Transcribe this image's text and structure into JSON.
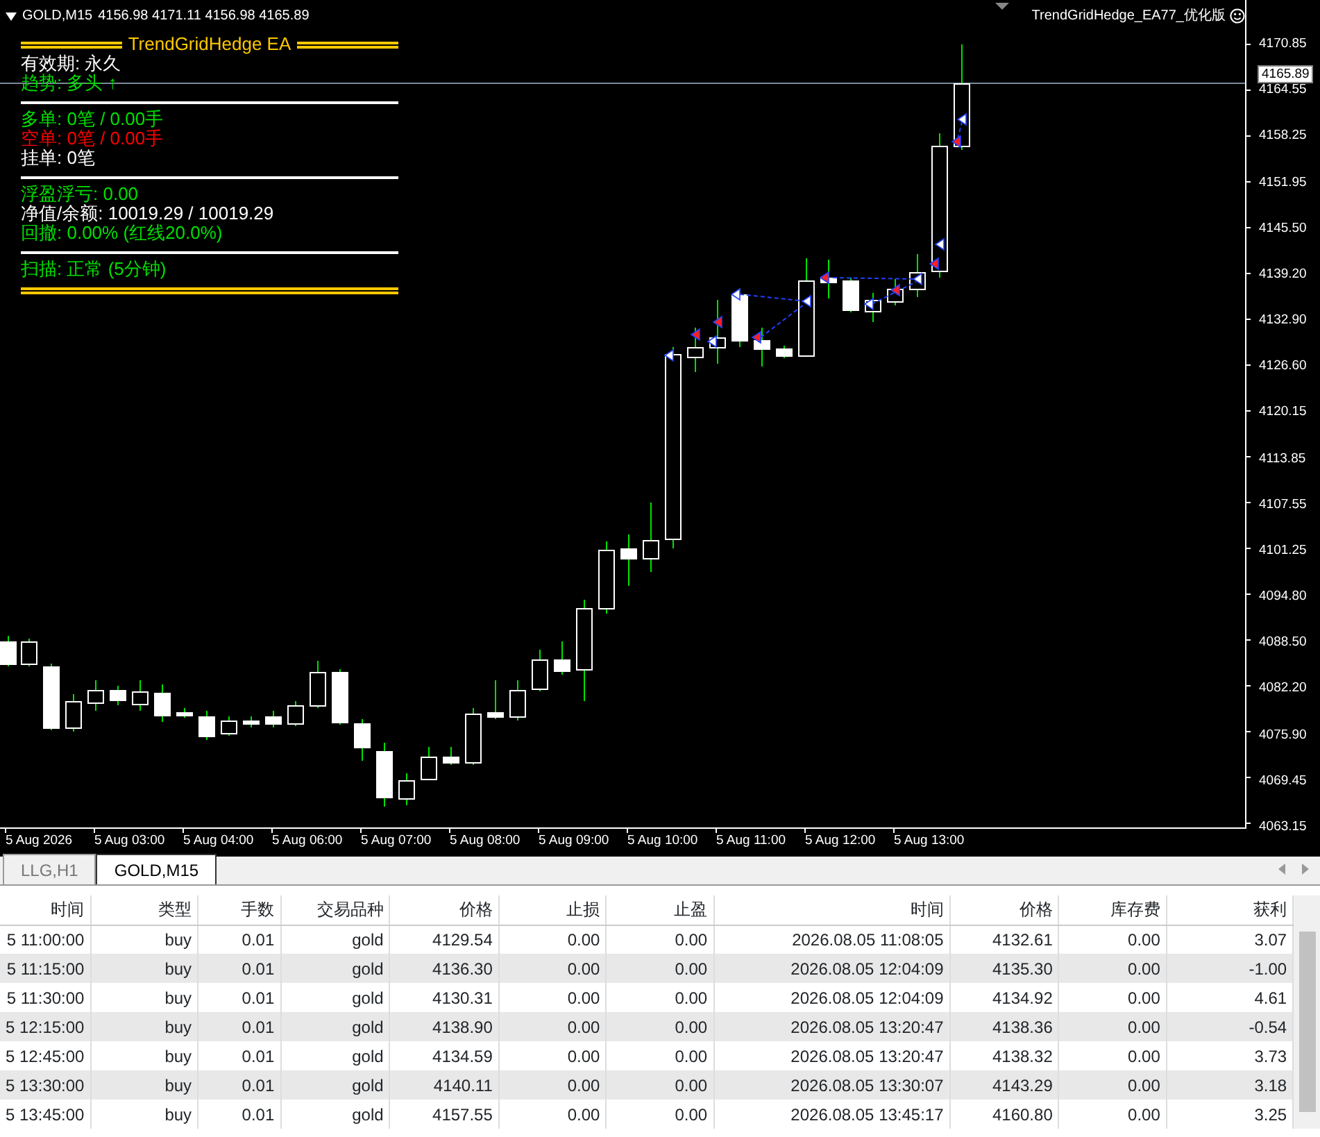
{
  "chart": {
    "symbol": "GOLD,M15",
    "ohlc": "4156.98 4171.11 4156.98 4165.89",
    "ea_name": "TrendGridHedge_EA77_优化版",
    "current_price": "4165.89",
    "price_axis": [
      "4170.85",
      "4164.55",
      "4158.25",
      "4151.95",
      "4145.50",
      "4139.20",
      "4132.90",
      "4126.60",
      "4120.15",
      "4113.85",
      "4107.55",
      "4101.25",
      "4094.80",
      "4088.50",
      "4082.20",
      "4075.90",
      "4069.45",
      "4063.15"
    ],
    "time_axis": [
      "5 Aug 2026",
      "5 Aug 03:00",
      "5 Aug 04:00",
      "5 Aug 06:00",
      "5 Aug 07:00",
      "5 Aug 08:00",
      "5 Aug 09:00",
      "5 Aug 10:00",
      "5 Aug 11:00",
      "5 Aug 12:00",
      "5 Aug 13:00"
    ]
  },
  "info_panel": {
    "title": "TrendGridHedge EA",
    "sections": [
      {
        "lines": [
          {
            "text": "有效期: 永久",
            "color": "#ffffff"
          },
          {
            "text": "趋势: 多头 ↑",
            "color": "#00e000"
          }
        ]
      },
      {
        "lines": [
          {
            "text": "多单: 0笔 / 0.00手",
            "color": "#00e000"
          },
          {
            "text": "空单: 0笔 / 0.00手",
            "color": "#ff0000"
          },
          {
            "text": "挂单: 0笔",
            "color": "#ffffff"
          }
        ]
      },
      {
        "lines": [
          {
            "text": "浮盈浮亏: 0.00",
            "color": "#00e000"
          },
          {
            "text": "净值/余额: 10019.29 / 10019.29",
            "color": "#ffffff"
          },
          {
            "text": "回撤: 0.00% (红线20.0%)",
            "color": "#00e000"
          }
        ]
      },
      {
        "lines": [
          {
            "text": "扫描: 正常 (5分钟)",
            "color": "#00e000"
          }
        ]
      }
    ]
  },
  "tabs": [
    {
      "label": "LLG,H1",
      "selected": false
    },
    {
      "label": "GOLD,M15",
      "selected": true
    }
  ],
  "table": {
    "columns": [
      "时间",
      "类型",
      "手数",
      "交易品种",
      "价格",
      "止损",
      "止盈",
      "时间",
      "价格",
      "库存费",
      "获利"
    ],
    "rows": [
      [
        "5 11:00:00",
        "buy",
        "0.01",
        "gold",
        "4129.54",
        "0.00",
        "0.00",
        "2026.08.05 11:08:05",
        "4132.61",
        "0.00",
        "3.07"
      ],
      [
        "5 11:15:00",
        "buy",
        "0.01",
        "gold",
        "4136.30",
        "0.00",
        "0.00",
        "2026.08.05 12:04:09",
        "4135.30",
        "0.00",
        "-1.00"
      ],
      [
        "5 11:30:00",
        "buy",
        "0.01",
        "gold",
        "4130.31",
        "0.00",
        "0.00",
        "2026.08.05 12:04:09",
        "4134.92",
        "0.00",
        "4.61"
      ],
      [
        "5 12:15:00",
        "buy",
        "0.01",
        "gold",
        "4138.90",
        "0.00",
        "0.00",
        "2026.08.05 13:20:47",
        "4138.36",
        "0.00",
        "-0.54"
      ],
      [
        "5 12:45:00",
        "buy",
        "0.01",
        "gold",
        "4134.59",
        "0.00",
        "0.00",
        "2026.08.05 13:20:47",
        "4138.32",
        "0.00",
        "3.73"
      ],
      [
        "5 13:30:00",
        "buy",
        "0.01",
        "gold",
        "4140.11",
        "0.00",
        "0.00",
        "2026.08.05 13:30:07",
        "4143.29",
        "0.00",
        "3.18"
      ],
      [
        "5 13:45:00",
        "buy",
        "0.01",
        "gold",
        "4157.55",
        "0.00",
        "0.00",
        "2026.08.05 13:45:17",
        "4160.80",
        "0.00",
        "3.25"
      ]
    ]
  }
}
